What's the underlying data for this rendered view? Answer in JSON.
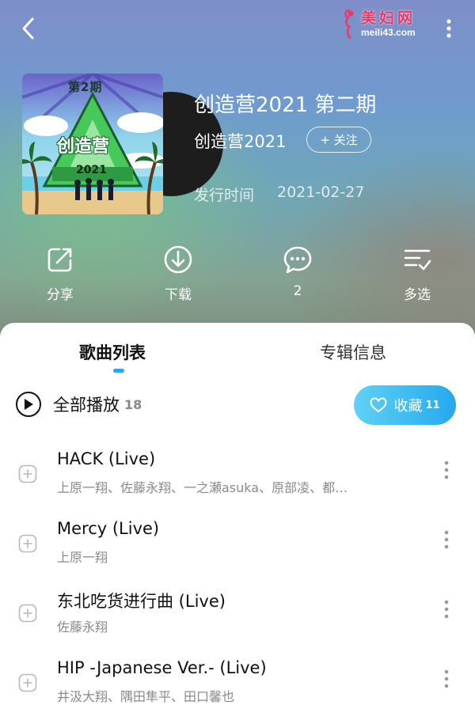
{
  "header": {
    "watermark_title": "美妇网",
    "watermark_url": "meili43.com",
    "back_icon": "chevron-left-icon",
    "more_icon": "more-vertical-icon"
  },
  "album": {
    "cover_issue": "第2期",
    "cover_name": "创造营",
    "cover_year": "2021",
    "title": "创造营2021 第二期",
    "artist": "创造营2021",
    "follow_label": "+ 关注",
    "release_label": "发行时间",
    "release_date": "2021-02-27"
  },
  "actions": [
    {
      "label": "分享",
      "icon": "share-icon"
    },
    {
      "label": "下载",
      "icon": "download-icon"
    },
    {
      "label": "2",
      "icon": "comment-icon"
    },
    {
      "label": "多选",
      "icon": "multi-select-icon"
    }
  ],
  "tabs": {
    "songs": "歌曲列表",
    "info": "专辑信息"
  },
  "playall": {
    "label": "全部播放",
    "count": "18"
  },
  "collect": {
    "label": "收藏",
    "count": "11"
  },
  "songs": [
    {
      "title": "HACK (Live)",
      "artists": "上原一翔、佐藤永翔、一之瀬asuka、原部凌、都…"
    },
    {
      "title": "Mercy (Live)",
      "artists": "上原一翔"
    },
    {
      "title": "东北吃货进行曲 (Live)",
      "artists": "佐藤永翔"
    },
    {
      "title": "HIP -Japanese Ver.- (Live)",
      "artists": "井汲大翔、隅田隼平、田口馨也"
    }
  ],
  "colors": {
    "accent": "#2ea7e8",
    "collect_start": "#5fd1f5",
    "collect_end": "#25a9ee"
  }
}
